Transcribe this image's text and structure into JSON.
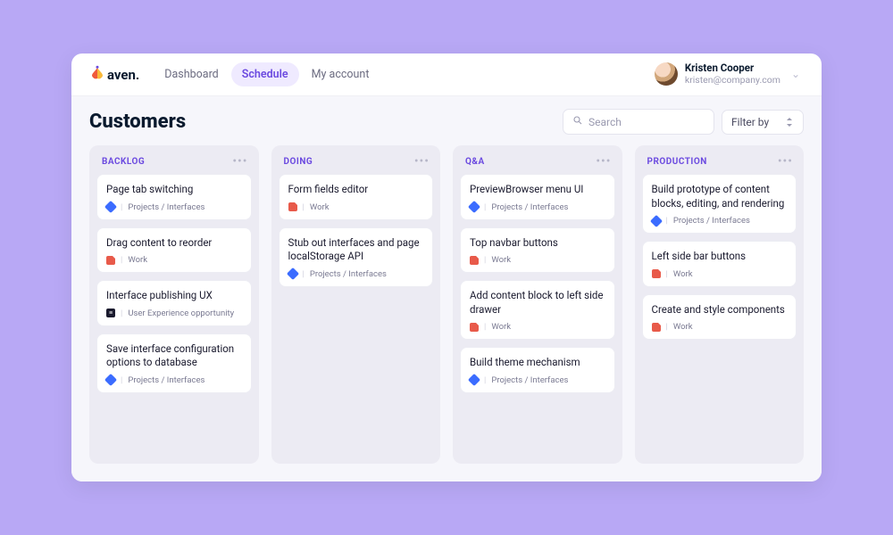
{
  "brand": "aven.",
  "nav": {
    "items": [
      {
        "label": "Dashboard",
        "active": false
      },
      {
        "label": "Schedule",
        "active": true
      },
      {
        "label": "My account",
        "active": false
      }
    ]
  },
  "user": {
    "name": "Kristen Cooper",
    "email": "kristen@company.com"
  },
  "page_title": "Customers",
  "search": {
    "placeholder": "Search"
  },
  "filter": {
    "label": "Filter by"
  },
  "tag_types": {
    "interfaces": {
      "icon": "blue",
      "label": "Projects / Interfaces"
    },
    "work": {
      "icon": "red",
      "label": "Work"
    },
    "ux": {
      "icon": "dark",
      "label": "User Experience opportunity"
    }
  },
  "columns": [
    {
      "title": "BACKLOG",
      "cards": [
        {
          "title": "Page tab switching",
          "tag": "interfaces"
        },
        {
          "title": "Drag content to reorder",
          "tag": "work"
        },
        {
          "title": "Interface publishing UX",
          "tag": "ux"
        },
        {
          "title": "Save interface configuration options to database",
          "tag": "interfaces"
        }
      ]
    },
    {
      "title": "DOING",
      "cards": [
        {
          "title": "Form fields editor",
          "tag": "work"
        },
        {
          "title": "Stub out interfaces and page localStorage API",
          "tag": "interfaces"
        }
      ]
    },
    {
      "title": "Q&A",
      "cards": [
        {
          "title": "PreviewBrowser menu UI",
          "tag": "interfaces"
        },
        {
          "title": "Top navbar buttons",
          "tag": "work"
        },
        {
          "title": "Add content block to left side drawer",
          "tag": "work"
        },
        {
          "title": "Build theme mechanism",
          "tag": "interfaces"
        }
      ]
    },
    {
      "title": "PRODUCTION",
      "cards": [
        {
          "title": "Build prototype of content blocks, editing, and rendering",
          "tag": "interfaces"
        },
        {
          "title": "Left side bar buttons",
          "tag": "work"
        },
        {
          "title": "Create and style components",
          "tag": "work"
        }
      ]
    }
  ]
}
